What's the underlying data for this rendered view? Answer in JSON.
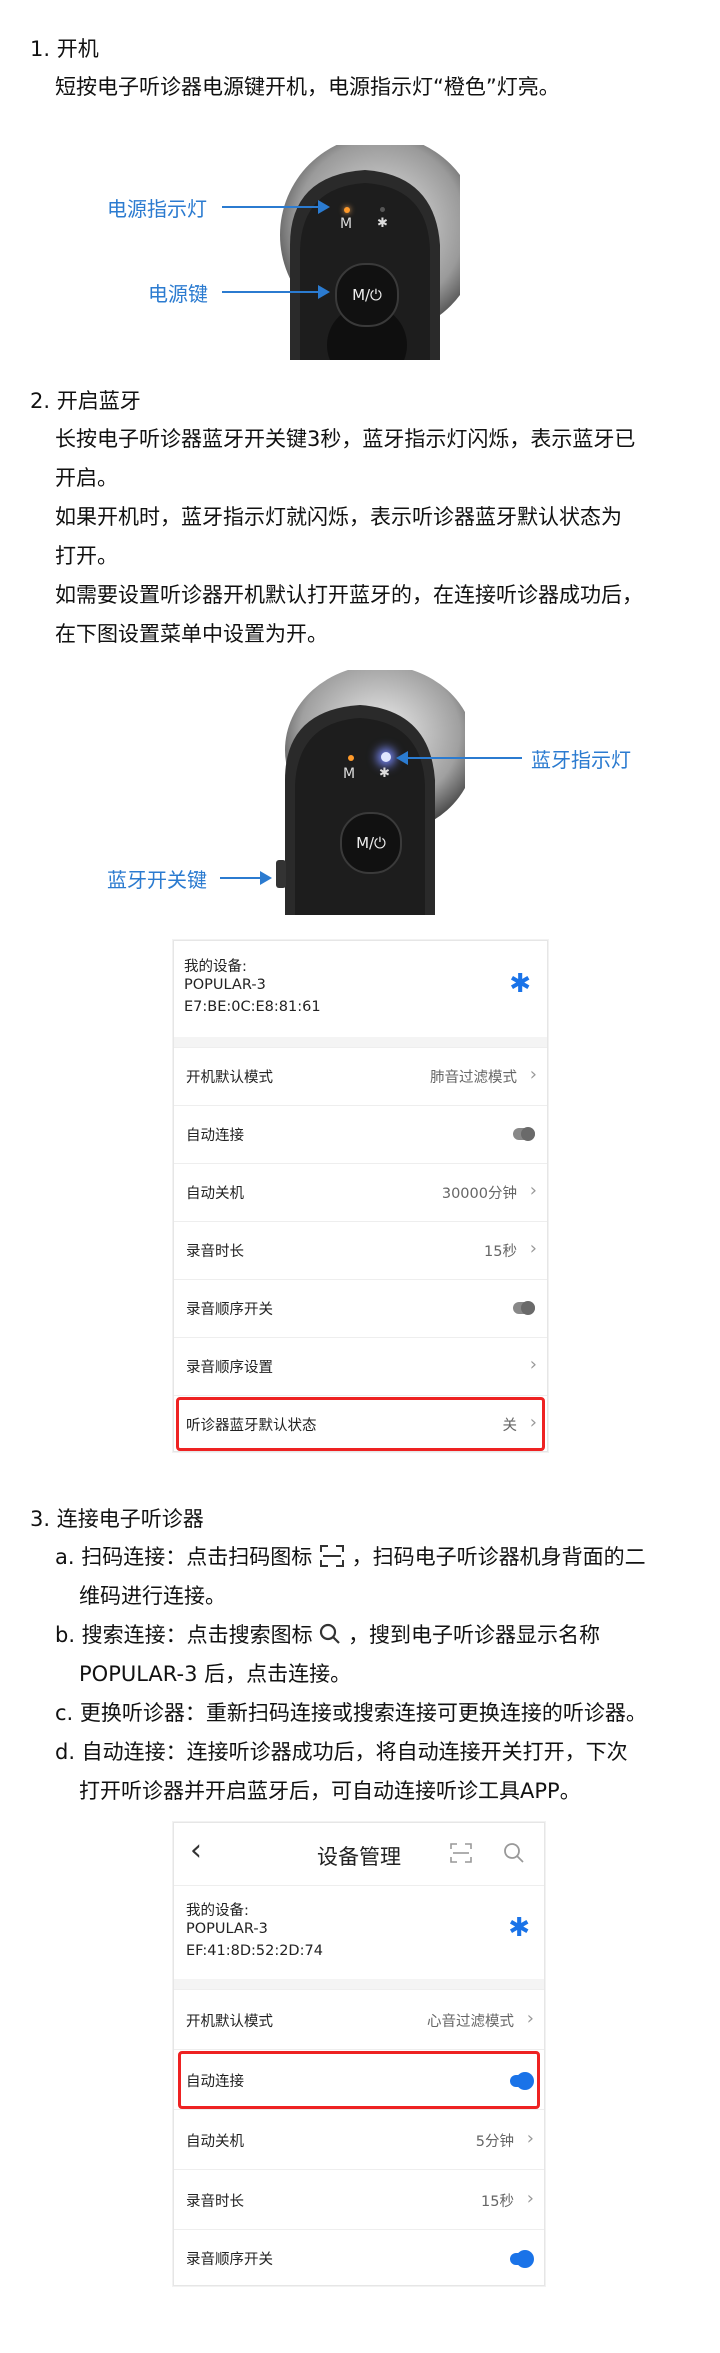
{
  "s1": {
    "heading": "1. 开机",
    "body": "短按电子听诊器电源键开机，电源指示灯“橙色”灯亮。",
    "callout_power_light": "电源指示灯",
    "callout_power_key": "电源键",
    "device_m": "M",
    "button_glyph": "M/⏻"
  },
  "s2": {
    "heading": "2. 开启蓝牙",
    "lines": [
      "长按电子听诊器蓝牙开关键3秒，蓝牙指示灯闪烁，表示蓝牙已",
      "开启。",
      "如果开机时，蓝牙指示灯就闪烁，表示听诊器蓝牙默认状态为",
      "打开。",
      "如需要设置听诊器开机默认打开蓝牙的，在连接听诊器成功后，",
      "在下图设置菜单中设置为开。"
    ],
    "callout_bt_light": "蓝牙指示灯",
    "callout_bt_key": "蓝牙开关键",
    "device_m": "M"
  },
  "shot1": {
    "device_title": "我的设备:",
    "device_name": "POPULAR-3",
    "device_mac": "E7:BE:0C:E8:81:61",
    "rows": [
      {
        "label": "开机默认模式",
        "value": "肺音过滤模式"
      },
      {
        "label": "自动连接",
        "value": ""
      },
      {
        "label": "自动关机",
        "value": "30000分钟"
      },
      {
        "label": "录音时长",
        "value": "15秒"
      },
      {
        "label": "录音顺序开关",
        "value": ""
      },
      {
        "label": "录音顺序设置",
        "value": ""
      },
      {
        "label": "听诊器蓝牙默认状态",
        "value": "关"
      }
    ]
  },
  "s3": {
    "heading": "3. 连接电子听诊器",
    "items": [
      {
        "line1": "a. 扫码连接：点击扫码图标",
        "line1b": "，扫码电子听诊器机身背面的二",
        "line2": "维码进行连接。"
      },
      {
        "line1": "b. 搜索连接：点击搜索图标",
        "line1b": "，搜到电子听诊器显示名称",
        "line2": "POPULAR-3 后，点击连接。"
      },
      {
        "line1": "c. 更换听诊器：重新扫码连接或搜索连接可更换连接的听诊器。"
      },
      {
        "line1": "d. 自动连接：连接听诊器成功后，将自动连接开关打开，下次",
        "line2": "打开听诊器并开启蓝牙后，可自动连接听诊工具APP。"
      }
    ]
  },
  "shot2": {
    "title": "设备管理",
    "device_title": "我的设备:",
    "device_name": "POPULAR-3",
    "device_mac": "EF:41:8D:52:2D:74",
    "rows": [
      {
        "label": "开机默认模式",
        "value": "心音过滤模式"
      },
      {
        "label": "自动连接",
        "value": ""
      },
      {
        "label": "自动关机",
        "value": "5分钟"
      },
      {
        "label": "录音时长",
        "value": "15秒"
      },
      {
        "label": "录音顺序开关",
        "value": ""
      }
    ]
  },
  "colors": {
    "accent": "#1a73e8",
    "callout": "#2b7bd0",
    "highlight": "#e22222",
    "orange_led": "#ff9a2a"
  }
}
